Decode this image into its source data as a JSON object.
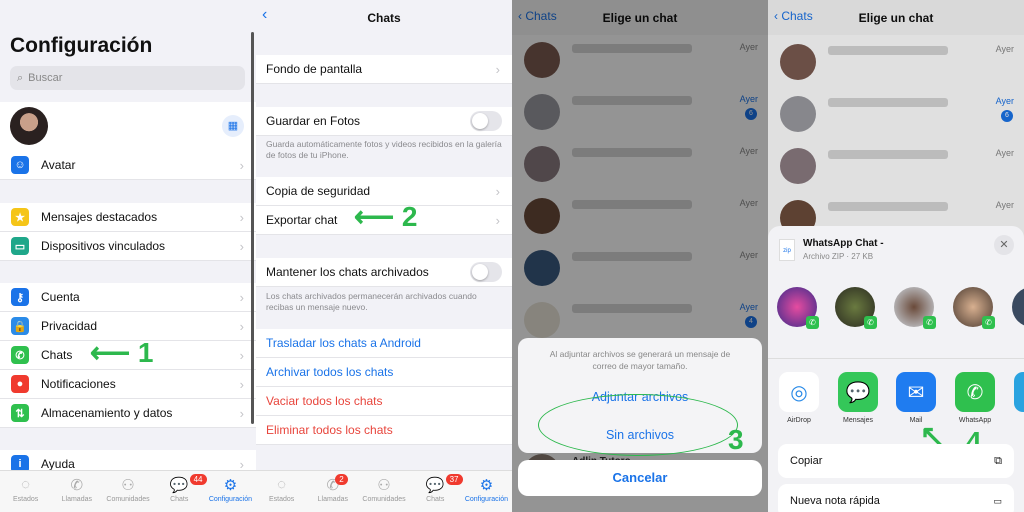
{
  "colors": {
    "accent": "#1a73e8",
    "danger": "#e8453c",
    "annotation": "#2db84d",
    "whatsapp": "#2fc04e"
  },
  "tabbar": {
    "tabs": [
      "Estados",
      "Llamadas",
      "Comunidades",
      "Chats",
      "Configuración"
    ]
  },
  "panel1": {
    "title": "Configuración",
    "search_placeholder": "Buscar",
    "groups": [
      [
        {
          "label": "Avatar",
          "icon": "avatar-icon",
          "color": "#1a73e8"
        }
      ],
      [
        {
          "label": "Mensajes destacados",
          "icon": "star-icon",
          "color": "#f5c518"
        },
        {
          "label": "Dispositivos vinculados",
          "icon": "laptop-icon",
          "color": "#1fa78a"
        }
      ],
      [
        {
          "label": "Cuenta",
          "icon": "key-icon",
          "color": "#1a73e8"
        },
        {
          "label": "Privacidad",
          "icon": "lock-icon",
          "color": "#2a8be8"
        },
        {
          "label": "Chats",
          "icon": "whatsapp-icon",
          "color": "#2fc04e"
        },
        {
          "label": "Notificaciones",
          "icon": "bell-icon",
          "color": "#f03a2e"
        },
        {
          "label": "Almacenamiento y datos",
          "icon": "arrows-icon",
          "color": "#2fc04e"
        }
      ],
      [
        {
          "label": "Ayuda",
          "icon": "info-icon",
          "color": "#1a73e8"
        }
      ]
    ],
    "chats_badge": "44",
    "annotation": "1"
  },
  "panel2": {
    "title": "Chats",
    "items": {
      "wallpaper": "Fondo de pantalla",
      "save_photos": "Guardar en Fotos",
      "save_note": "Guarda automáticamente fotos y videos recibidos en la galería de fotos de tu iPhone.",
      "backup": "Copia de seguridad",
      "export": "Exportar chat",
      "keep_archived": "Mantener los chats archivados",
      "keep_note": "Los chats archivados permanecerán archivados cuando recibas un mensaje nuevo.",
      "move_android": "Trasladar los chats a Android",
      "archive_all": "Archivar todos los chats",
      "clear_all": "Vaciar todos los chats",
      "delete_all": "Eliminar todos los chats"
    },
    "save_photos_on": false,
    "keep_archived_on": false,
    "calls_badge": "2",
    "chats_badge": "37",
    "annotation": "2"
  },
  "panel3": {
    "back": "Chats",
    "title": "Elige un chat",
    "chats": [
      {
        "time": "Ayer"
      },
      {
        "time": "Ayer",
        "unread": "6"
      },
      {
        "time": "Ayer"
      },
      {
        "time": "Ayer"
      },
      {
        "time": "Ayer"
      },
      {
        "time": "Ayer",
        "unread": "4"
      }
    ],
    "sheet_message": "Al adjuntar archivos se generará un mensaje de correo de mayor tamaño.",
    "attach": "Adjuntar archivos",
    "no_attach": "Sin archivos",
    "cancel": "Cancelar",
    "partial_chat_name": "Adlin Tutoro",
    "annotation": "3"
  },
  "panel4": {
    "back": "Chats",
    "title": "Elige un chat",
    "chats": [
      {
        "time": "Ayer"
      },
      {
        "time": "Ayer",
        "unread": "6"
      },
      {
        "time": "Ayer"
      },
      {
        "time": "Ayer"
      }
    ],
    "file_title": "WhatsApp Chat -",
    "file_sub": "Archivo ZIP · 27 KB",
    "file_icon_text": "zip",
    "apps": [
      {
        "label": "AirDrop",
        "icon": "airdrop-icon"
      },
      {
        "label": "Mensajes",
        "icon": "messages-icon"
      },
      {
        "label": "Mail",
        "icon": "mail-icon"
      },
      {
        "label": "WhatsApp",
        "icon": "whatsapp-icon"
      },
      {
        "label": "Te",
        "icon": "telegram-icon"
      }
    ],
    "actions": [
      "Copiar",
      "Nueva nota rápida"
    ],
    "annotation": "4"
  }
}
